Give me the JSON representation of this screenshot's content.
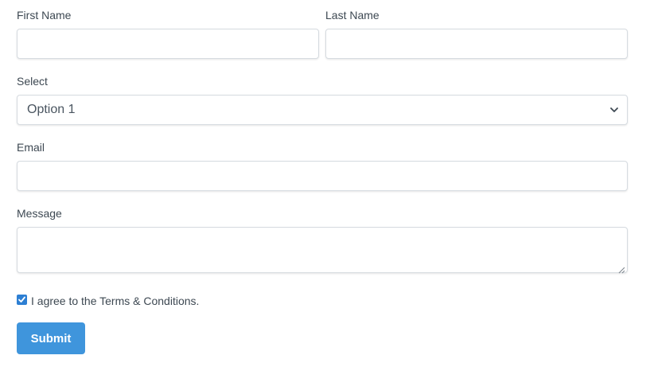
{
  "form": {
    "first_name": {
      "label": "First Name",
      "value": "",
      "placeholder": ""
    },
    "last_name": {
      "label": "Last Name",
      "value": "",
      "placeholder": ""
    },
    "select": {
      "label": "Select",
      "selected": "Option 1"
    },
    "email": {
      "label": "Email",
      "value": "",
      "placeholder": ""
    },
    "message": {
      "label": "Message",
      "value": "",
      "placeholder": ""
    },
    "agree": {
      "label": "I agree to the Terms & Conditions.",
      "checked": true
    },
    "submit_label": "Submit"
  },
  "colors": {
    "accent": "#3f95dc",
    "checkbox": "#2d7fd3",
    "input_border": "#d6dbe0",
    "text": "#3d4852"
  },
  "icons": {
    "select_arrow": "chevron-down-icon",
    "textarea_resize": "resize-grip-icon",
    "checkbox_mark": "checkmark-icon"
  }
}
